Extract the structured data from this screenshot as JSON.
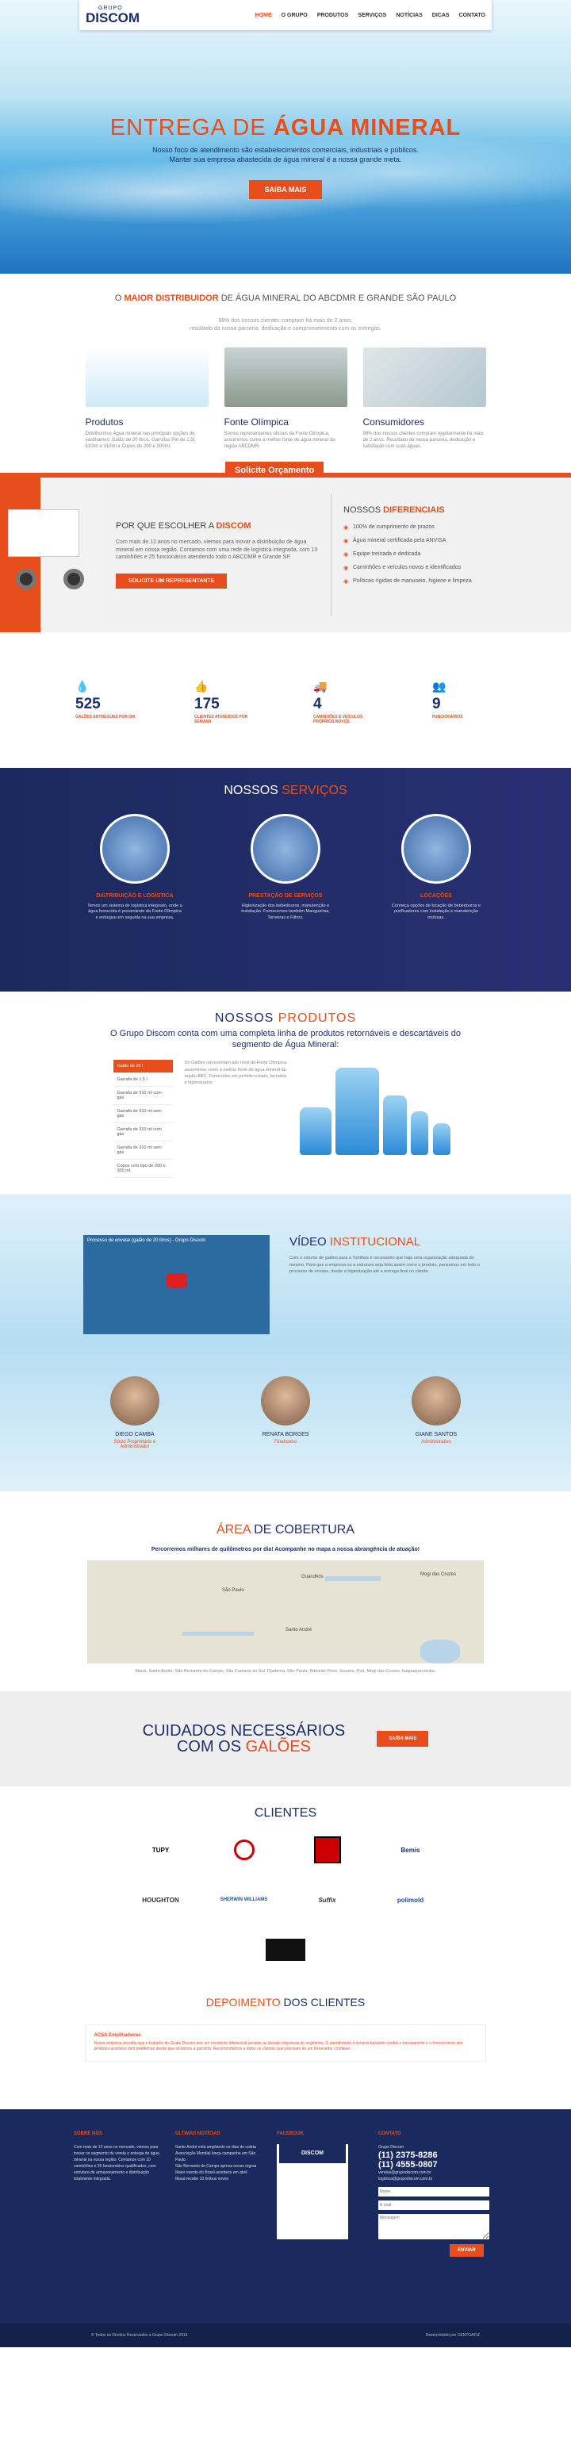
{
  "header": {
    "logo_grupo": "GRUPO",
    "logo_main": "DISCOM",
    "nav": [
      "HOME",
      "O GRUPO",
      "PRODUTOS",
      "SERVIÇOS",
      "NOTÍCIAS",
      "DICAS",
      "CONTATO"
    ]
  },
  "hero": {
    "title_a": "ENTREGA DE ",
    "title_b": "ÁGUA MINERAL",
    "line1": "Nosso foco de atendimento são estabelecimentos comerciais, industriais e públicos.",
    "line2": "Manter sua empresa abastecida de água mineral é a nossa grande meta.",
    "button": "SAIBA MAIS"
  },
  "intro": {
    "a": "O ",
    "b": "MAIOR DISTRIBUIDOR",
    "c": " DE ÁGUA MINERAL DO ABCDMR E GRANDE SÃO PAULO",
    "sub1": "98% dos nossos clientes compram há mais de 2 anos,",
    "sub2": "resultado da nossa parceria, dedicação e comprometimento com as entregas.",
    "cards": [
      {
        "title": "Produtos",
        "text": "Distribuímos Água mineral nas principais opções de vasilhames: Galão de 20 litros, Garrafas Pet de 1,5l, 510ml e 310ml e Copos de 200 e 300ml."
      },
      {
        "title": "Fonte Olímpica",
        "text": "Somos representantes oficiais da Fonte Olímpica, assumimos como a melhor fonte de água mineral da região ABCDMR."
      },
      {
        "title": "Consumidores",
        "text": "98% dos nossos clientes compram regularmente há mais de 2 anos. Resultado de nossa parceria, dedicação e satisfação com suas águas."
      }
    ]
  },
  "orcamento": {
    "label": "Solicite Orçamento"
  },
  "why": {
    "title_a": "POR QUE ESCOLHER A ",
    "title_b": "DISCOM",
    "text": "Com mais de 12 anos no mercado, viemos para inovar a distribuição de água mineral em nossa região. Contamos com uma rede de logística integrada, com 10 caminhões e 25 funcionários atendendo todo o ABCDMR e Grande SP.",
    "button": "SOLICITE UM REPRESENTANTE",
    "dif_a": "NOSSOS ",
    "dif_b": "DIFERENCIAIS",
    "items": [
      "100% de cumprimento de prazos",
      "Água mineral certificada pela ANVISA",
      "Equipe treinada e dedicada",
      "Caminhões e veículos novos e identificados",
      "Políticas rígidas de manuseio, higiene e limpeza"
    ]
  },
  "stats": [
    {
      "icon": "drop-icon",
      "num": "525",
      "label": "GALÕES ENTREGUES POR DIA"
    },
    {
      "icon": "thumbs-up-icon",
      "num": "175",
      "label": "CLIENTES ATENDIDOS POR SEMANA"
    },
    {
      "icon": "truck-icon",
      "num": "4",
      "label": "CAMINHÕES E VEÍCULOS PRÓPRIOS NOVOS"
    },
    {
      "icon": "people-icon",
      "num": "9",
      "label": "FUNCIONÁRIOS"
    }
  ],
  "servicos": {
    "title_a": "NOSSOS ",
    "title_b": "SERVIÇOS",
    "items": [
      {
        "title": "DISTRIBUIÇÃO E LOGÍSTICA",
        "text": "Temos um sistema de logística integrado, onde a água fornecida é proveniente da Fonte Olímpica e entregue em seguida na sua empresa."
      },
      {
        "title": "PRESTAÇÃO DE SERVIÇOS",
        "text": "Higienização dos bebedouros, manutenção e instalação. Fornecemos também Mangueiras, Torneiras e Filtros."
      },
      {
        "title": "LOCAÇÕES",
        "text": "Conheça opções de locação de bebedouros e purificadores com instalação e manutenção inclusas."
      }
    ]
  },
  "produtos": {
    "title_a": "NOSSOS  ",
    "title_b": "PRODUTOS",
    "sub1": "O Grupo Discom conta com uma completa linha de produtos retornáveis e descartáveis do",
    "sub2": "segmento de Água Mineral:",
    "tabs": [
      "Galão de 20 l",
      "Garrafa de 1,5 l",
      "Garrafa de 510 ml com gás",
      "Garrafa de 510 ml sem gás",
      "Garrafa de 310 ml com gás",
      "Garrafa de 310 ml sem gás",
      "Copos com tipo de 200 e 300 ml"
    ],
    "text": "Os Galões representam alto nível da Fonte Olímpica, assumimos como a melhor fonte de água mineral da região ABC. Fornecidos em perfeito estado, lacrados e higienizados."
  },
  "video": {
    "title_a": "VÍDEO ",
    "title_b": "INSTITUCIONAL",
    "vid_title": "Processo de envase (galão de 20 litros) - Grupo Discom",
    "text": "Com o volume de galões para a Tortilhas é necessário que haja uma organização adequada do mesmo. Para que a empresa ou a estrutura seja feita assim como o produto, pensamos em todo o processo de envase, desde a higienização até a entrega final no cliente.",
    "team": [
      {
        "name": "DIEGO CAMBA",
        "role": "Sócio Proprietário e Administrador"
      },
      {
        "name": "RENATA BORGES",
        "role": "Financeiro"
      },
      {
        "name": "GIANE SANTOS",
        "role": "Administrativo"
      }
    ]
  },
  "cobertura": {
    "title_a": "ÁREA ",
    "title_b": " DE COBERTURA",
    "sub": "Percorremos milhares de quilômetros por dia! Acompanhe no mapa a nossa abrangência de atuação!",
    "city1": "São Paulo",
    "city2": "Santo André",
    "city3": "Guarulhos",
    "city4": "Mogi das Cruzes",
    "cities": "Mauá, Santo André, São Bernardo do Campo, São Caetano do Sul, Diadema, São Paulo, Ribeirão Pires, Suzano, Poá, Mogi das Cruzes, Itaquaquecetuba."
  },
  "cuidados": {
    "line1": "CUIDADOS NECESSÁRIOS",
    "line2a": "COM OS ",
    "line2b": "GALÕES",
    "button": "SAIBA MAIS"
  },
  "clientes": {
    "title": "CLIENTES",
    "logos": [
      "TUPY",
      "",
      "",
      "Bemis",
      "HOUGHTON",
      "SHERWIN WILLIAMS",
      "Suffix",
      "polimold",
      ""
    ]
  },
  "depoimento": {
    "title_a": "DEPOIMENTO",
    "title_b": " DOS CLIENTES",
    "name": "ACSA Empilhadeiras",
    "text": "Nossa empresa acredita que o trabalho do Grupo Discom tem um excelente diferencial perante as demais empresas do segmento. O atendimento é sempre bastante cordial e transparente e o fornecimento dos produtos acontece sem problemas desde que iniciamos a parceria. Recomendamos a todos os clientes que precisam de um fornecedor confiável."
  },
  "footer": {
    "sobre_title": "SOBRE NÓS",
    "sobre_text": "Com mais de 12 anos no mercado, viemos para inovar no segmento de venda e entrega de água mineral na nossa região. Contamos com 10 caminhões e 25 funcionários qualificados, com estrutura de armazenamento e distribuição totalmente integrada.",
    "news_title": "ÚLTIMAS NOTÍCIAS",
    "news": [
      "Santo André está ampliando os dias de coleta",
      "Associação Mundial lança campanha em São Paulo",
      "São Bernardo do Campo aprova novas regras",
      "Maior evento do Brasil acontece em abril",
      "Mauá recebe 10 ônibus novos"
    ],
    "fb_title": "FACEBOOK",
    "contato_title": "CONTATO",
    "company": "Grupo Discom",
    "phone1": "(11) 2375-8286",
    "phone2": "(11) 4555-0807",
    "email1": "vendas@grupodiscom.com.br",
    "email2": "logistica@grupodiscom.com.br",
    "ph_nome": "Nome",
    "ph_email": "E-mail",
    "ph_msg": "Mensagem",
    "send": "ENVIAR",
    "copy": "© Todos os Direitos Reservados a Grupo Discom 2015",
    "dev": "Desenvolvido por CENTOAFIZ"
  }
}
